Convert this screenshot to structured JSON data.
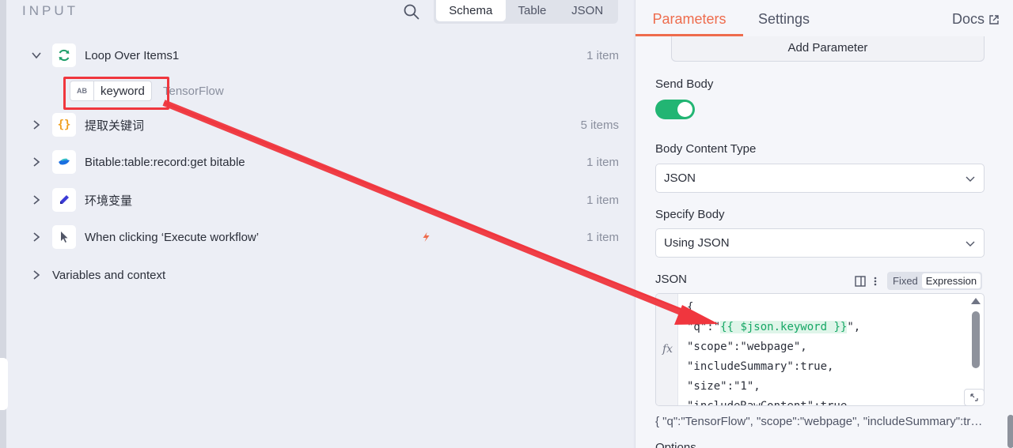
{
  "input_panel": {
    "title": "INPUT",
    "view_tabs": [
      "Schema",
      "Table",
      "JSON"
    ],
    "active_view": "Schema",
    "nodes": [
      {
        "label": "Loop Over Items1",
        "count": "1 item",
        "icon": "loop-icon",
        "expanded": true
      },
      {
        "label": "提取关键词",
        "count": "5 items",
        "icon": "code-braces-icon",
        "expanded": false
      },
      {
        "label": "Bitable:table:record:get bitable",
        "count": "1 item",
        "icon": "feishu-icon",
        "expanded": false
      },
      {
        "label": "环境变量",
        "count": "1 item",
        "icon": "pencil-icon",
        "expanded": false
      },
      {
        "label": "When clicking ‘Execute workflow’",
        "count": "1 item",
        "icon": "cursor-icon",
        "expanded": false
      }
    ],
    "variables_label": "Variables and context",
    "keyword_field": {
      "type": "AB",
      "name": "keyword",
      "value": "TensorFlow"
    }
  },
  "right_panel": {
    "tabs": {
      "parameters": "Parameters",
      "settings": "Settings",
      "docs": "Docs"
    },
    "add_parameter": "Add Parameter",
    "send_body_label": "Send Body",
    "send_body_on": true,
    "body_content_type_label": "Body Content Type",
    "body_content_type_value": "JSON",
    "specify_body_label": "Specify Body",
    "specify_body_value": "Using JSON",
    "json_label": "JSON",
    "mode_fixed": "Fixed",
    "mode_expression": "Expression",
    "fx": "fx",
    "code_lines": {
      "l1": "{",
      "l2_pre": "\"q\":\"",
      "l2_expr": "{{ $json.keyword }}",
      "l2_post": "\",",
      "l3": "\"scope\":\"webpage\",",
      "l4": "\"includeSummary\":true,",
      "l5": "\"size\":\"1\",",
      "l6": "\"includeRawContent\":true"
    },
    "json_preview": "{ \"q\":\"TensorFlow\", \"scope\":\"webpage\", \"includeSummary\":true, \"size\":\"1\", \"includeRawContent\":true }",
    "options_label": "Options"
  },
  "colors": {
    "accent": "#ee6c4d",
    "toggle": "#22b573",
    "annotation": "#f0363e",
    "expression": "#16a765"
  }
}
